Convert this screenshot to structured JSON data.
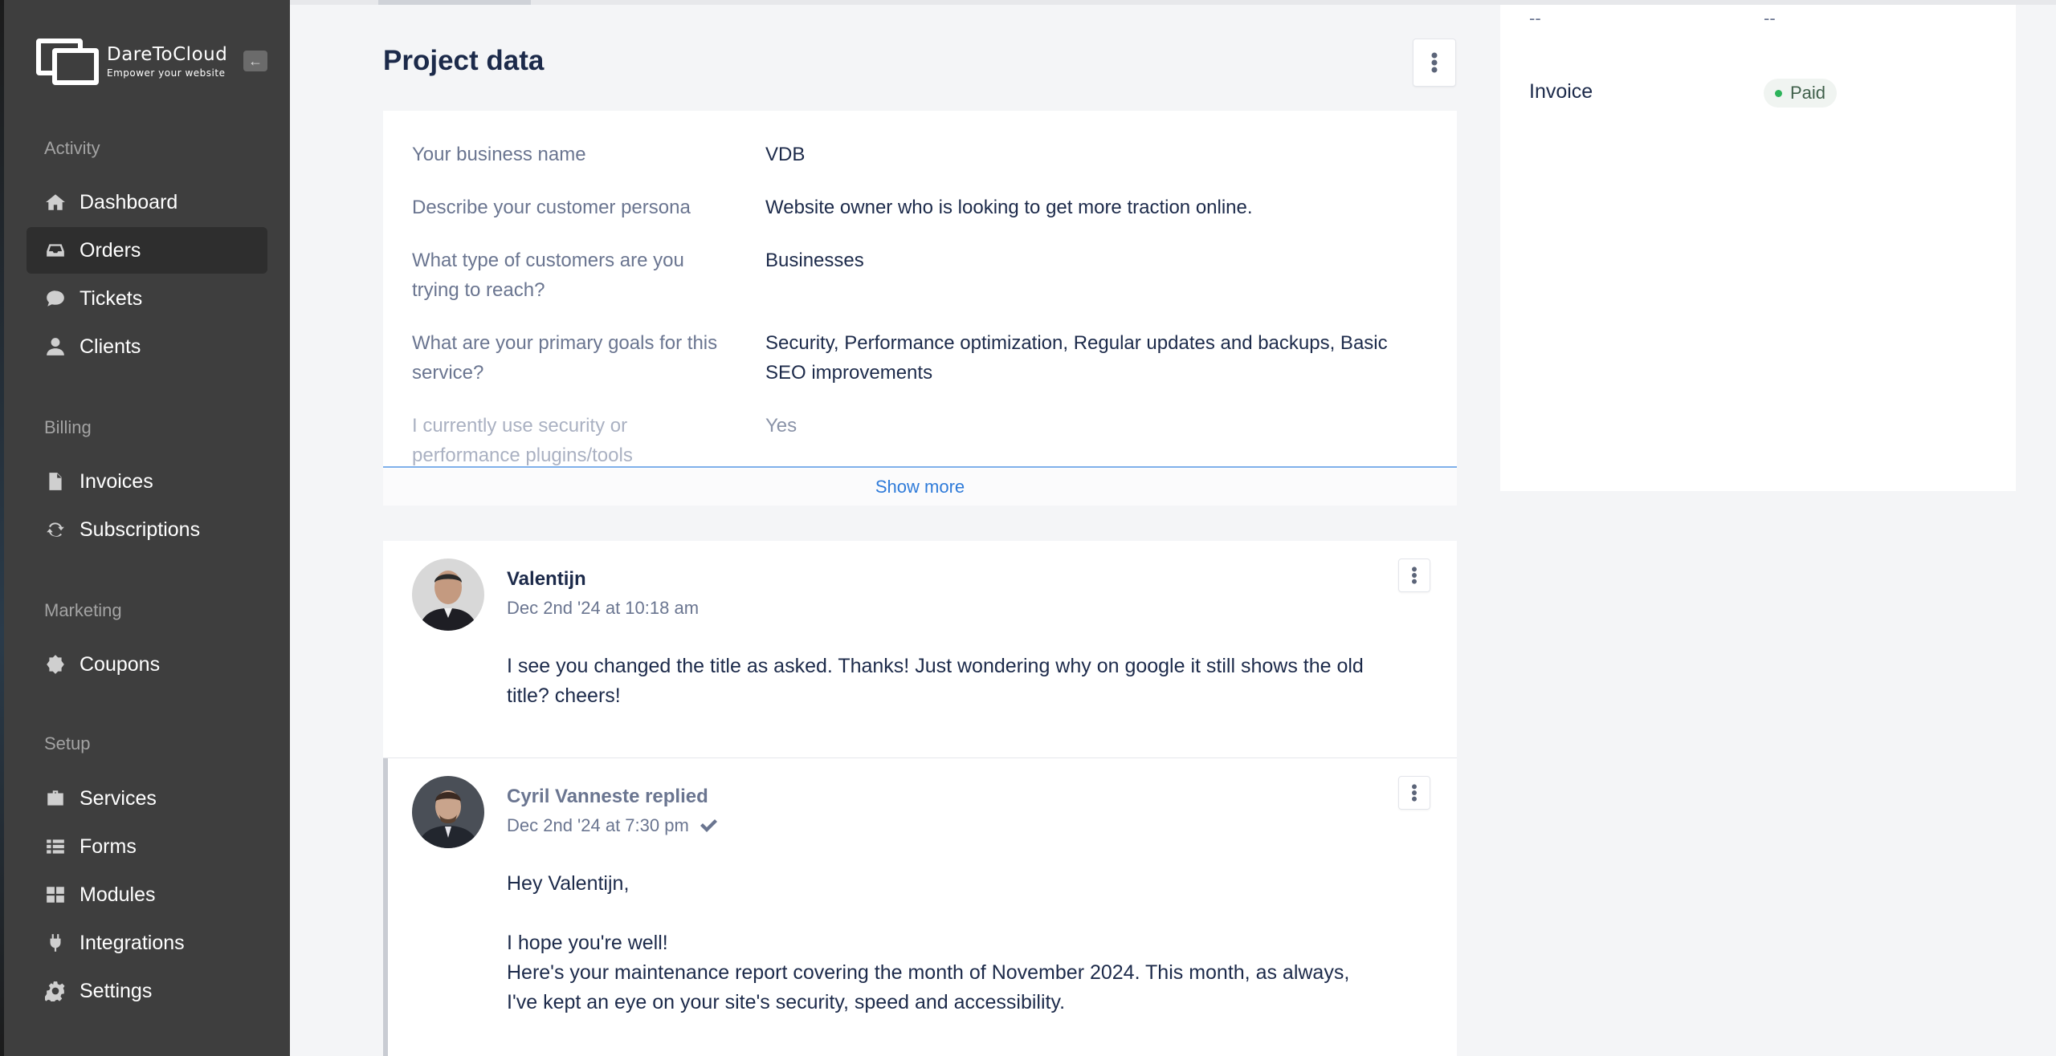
{
  "brand": {
    "name": "DareToCloud",
    "tagline": "Empower your website"
  },
  "sidebar": {
    "sections": [
      {
        "title": "Activity",
        "items": [
          {
            "label": "Dashboard",
            "icon": "home-icon"
          },
          {
            "label": "Orders",
            "icon": "inbox-icon",
            "active": true
          },
          {
            "label": "Tickets",
            "icon": "chat-bubble-icon"
          },
          {
            "label": "Clients",
            "icon": "user-icon"
          }
        ]
      },
      {
        "title": "Billing",
        "items": [
          {
            "label": "Invoices",
            "icon": "file-icon"
          },
          {
            "label": "Subscriptions",
            "icon": "refresh-icon"
          }
        ]
      },
      {
        "title": "Marketing",
        "items": [
          {
            "label": "Coupons",
            "icon": "coupon-badge-icon"
          }
        ]
      },
      {
        "title": "Setup",
        "items": [
          {
            "label": "Services",
            "icon": "briefcase-icon"
          },
          {
            "label": "Forms",
            "icon": "list-icon"
          },
          {
            "label": "Modules",
            "icon": "grid-icon"
          },
          {
            "label": "Integrations",
            "icon": "plug-icon"
          },
          {
            "label": "Settings",
            "icon": "gear-icon"
          }
        ]
      }
    ]
  },
  "project": {
    "title": "Project data",
    "fields": [
      {
        "label": "Your business name",
        "value": "VDB"
      },
      {
        "label": "Describe your customer persona",
        "value": "Website owner who is looking to get more traction online."
      },
      {
        "label": "What type of customers are you trying to reach?",
        "value": "Businesses"
      },
      {
        "label": "What are your primary goals for this service?",
        "value": "Security, Performance optimization, Regular updates and backups, Basic SEO improvements"
      },
      {
        "label": "I currently use security or performance plugins/tools",
        "value": "Yes"
      }
    ],
    "show_more": "Show more"
  },
  "comments": [
    {
      "author": "Valentijn",
      "timestamp": "Dec 2nd '24 at 10:18 am",
      "body": "I see you changed the title as asked. Thanks! Just wondering why on google it still shows the old title? cheers!"
    },
    {
      "author": "Cyril Vanneste replied",
      "timestamp": "Dec 2nd '24 at 7:30 pm",
      "greeting": "Hey Valentijn,",
      "line1": "I hope you're well!",
      "line2": "Here's your maintenance report covering the month of November 2024. This month, as always, I've kept an eye on your site's security, speed and accessibility."
    }
  ],
  "right_panel": {
    "dash_1": "--",
    "dash_2": "--",
    "invoice_label": "Invoice",
    "invoice_status": "Paid",
    "status_color": "#2cb35a"
  }
}
